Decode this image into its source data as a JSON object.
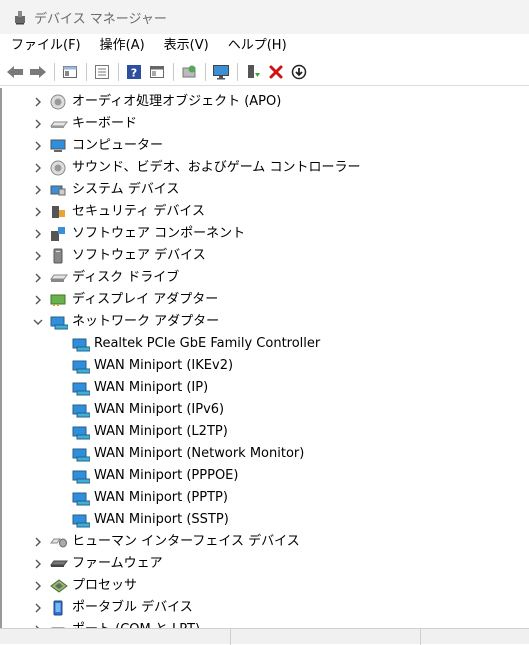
{
  "window": {
    "title": "デバイス マネージャー"
  },
  "menu": [
    {
      "label": "ファイル(F)"
    },
    {
      "label": "操作(A)"
    },
    {
      "label": "表示(V)"
    },
    {
      "label": "ヘルプ(H)"
    }
  ],
  "toolbar_icons": [
    "back-arrow-icon",
    "forward-arrow-icon",
    "properties-icon",
    "update-driver-icon",
    "help-icon",
    "console-icon",
    "scan-hardware-icon",
    "monitor-icon",
    "enable-device-icon",
    "uninstall-icon",
    "download-icon"
  ],
  "tree": [
    {
      "label": "オーディオ処理オブジェクト (APO)",
      "icon": "speaker-icon",
      "level": 0,
      "expanded": false
    },
    {
      "label": "キーボード",
      "icon": "keyboard-icon",
      "level": 0,
      "expanded": false
    },
    {
      "label": "コンピューター",
      "icon": "computer-icon",
      "level": 0,
      "expanded": false
    },
    {
      "label": "サウンド、ビデオ、およびゲーム コントローラー",
      "icon": "speaker-icon",
      "level": 0,
      "expanded": false
    },
    {
      "label": "システム デバイス",
      "icon": "system-device-icon",
      "level": 0,
      "expanded": false
    },
    {
      "label": "セキュリティ デバイス",
      "icon": "security-device-icon",
      "level": 0,
      "expanded": false
    },
    {
      "label": "ソフトウェア コンポーネント",
      "icon": "software-component-icon",
      "level": 0,
      "expanded": false
    },
    {
      "label": "ソフトウェア デバイス",
      "icon": "software-device-icon",
      "level": 0,
      "expanded": false
    },
    {
      "label": "ディスク ドライブ",
      "icon": "disk-drive-icon",
      "level": 0,
      "expanded": false
    },
    {
      "label": "ディスプレイ アダプター",
      "icon": "display-adapter-icon",
      "level": 0,
      "expanded": false
    },
    {
      "label": "ネットワーク アダプター",
      "icon": "network-adapter-icon",
      "level": 0,
      "expanded": true
    },
    {
      "label": "Realtek PCIe GbE Family Controller",
      "icon": "network-adapter-icon",
      "level": 1
    },
    {
      "label": "WAN Miniport (IKEv2)",
      "icon": "network-adapter-icon",
      "level": 1
    },
    {
      "label": "WAN Miniport (IP)",
      "icon": "network-adapter-icon",
      "level": 1
    },
    {
      "label": "WAN Miniport (IPv6)",
      "icon": "network-adapter-icon",
      "level": 1
    },
    {
      "label": "WAN Miniport (L2TP)",
      "icon": "network-adapter-icon",
      "level": 1
    },
    {
      "label": "WAN Miniport (Network Monitor)",
      "icon": "network-adapter-icon",
      "level": 1
    },
    {
      "label": "WAN Miniport (PPPOE)",
      "icon": "network-adapter-icon",
      "level": 1
    },
    {
      "label": "WAN Miniport (PPTP)",
      "icon": "network-adapter-icon",
      "level": 1
    },
    {
      "label": "WAN Miniport (SSTP)",
      "icon": "network-adapter-icon",
      "level": 1
    },
    {
      "label": "ヒューマン インターフェイス デバイス",
      "icon": "hid-icon",
      "level": 0,
      "expanded": false
    },
    {
      "label": "ファームウェア",
      "icon": "firmware-icon",
      "level": 0,
      "expanded": false
    },
    {
      "label": "プロセッサ",
      "icon": "processor-icon",
      "level": 0,
      "expanded": false
    },
    {
      "label": "ポータブル デバイス",
      "icon": "portable-device-icon",
      "level": 0,
      "expanded": false
    },
    {
      "label": "ポート (COM と LPT)",
      "icon": "port-icon",
      "level": 0,
      "expanded": false
    }
  ]
}
